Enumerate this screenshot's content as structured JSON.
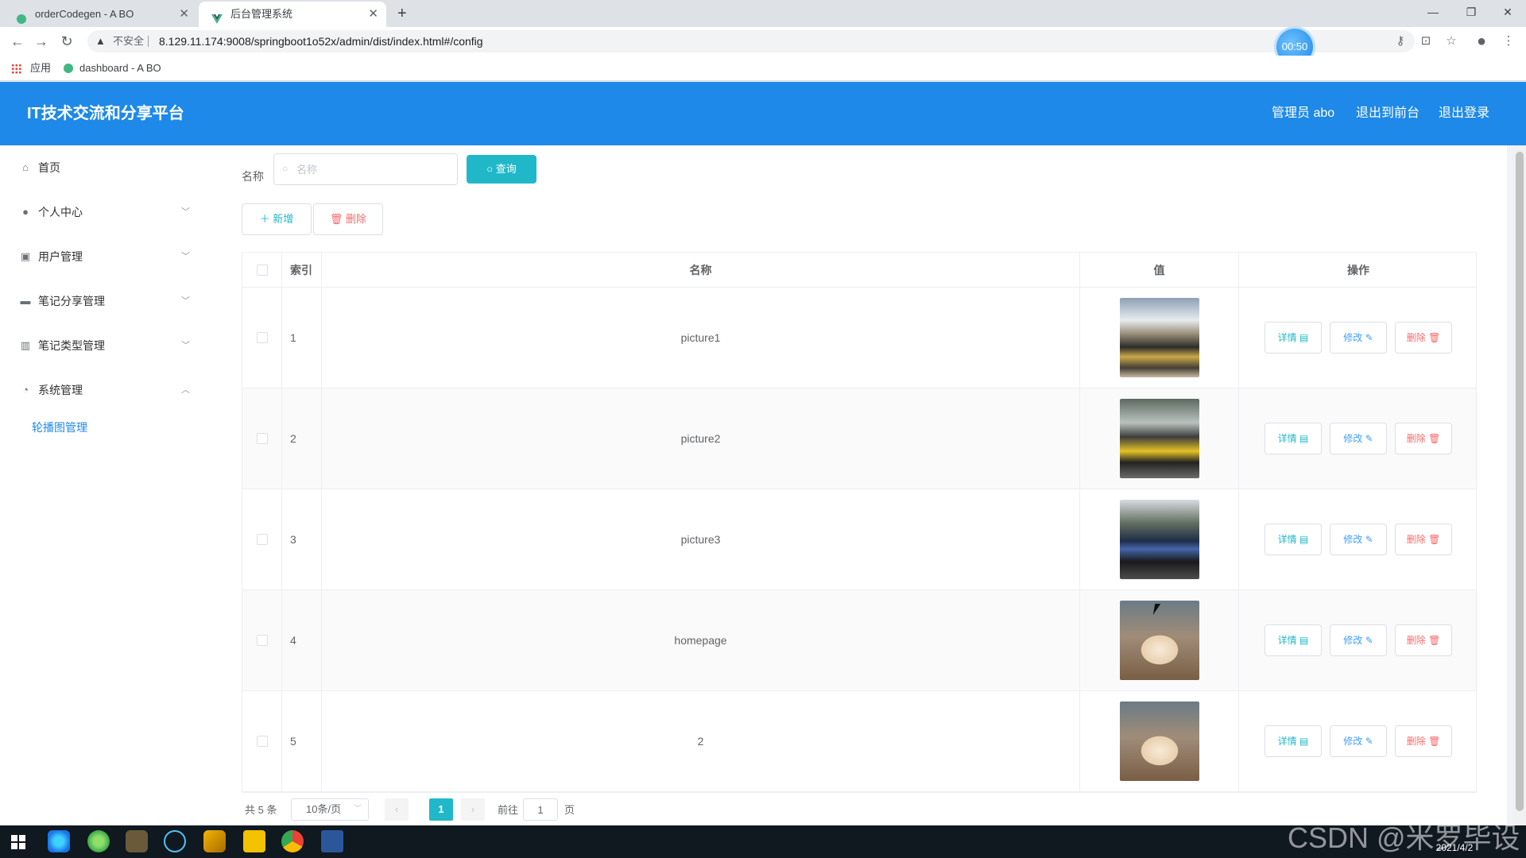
{
  "browser": {
    "tabs": [
      {
        "label": "orderCodegen - A BO",
        "active": false
      },
      {
        "label": "后台管理系统",
        "active": true
      }
    ],
    "security_label": "不安全",
    "url": "8.129.11.174:9008/springboot1o52x/admin/dist/index.html#/config",
    "timer": "00:50",
    "bookmarks": [
      {
        "label": "应用"
      },
      {
        "label": "dashboard - A BO"
      }
    ]
  },
  "header": {
    "title": "IT技术交流和分享平台",
    "links": [
      {
        "label": "管理员 abo"
      },
      {
        "label": "退出到前台"
      },
      {
        "label": "退出登录"
      }
    ]
  },
  "sidebar": {
    "items": [
      {
        "label": "首页",
        "icon": "home-icon"
      },
      {
        "label": "个人中心",
        "icon": "user-icon",
        "expanded": false
      },
      {
        "label": "用户管理",
        "icon": "clipboard-icon",
        "expanded": false
      },
      {
        "label": "笔记分享管理",
        "icon": "briefcase-icon",
        "expanded": false
      },
      {
        "label": "笔记类型管理",
        "icon": "chart-icon",
        "expanded": false
      },
      {
        "label": "系统管理",
        "icon": "compass-icon",
        "expanded": true
      }
    ],
    "submenu": [
      {
        "label": "轮播图管理",
        "active": true
      }
    ]
  },
  "search": {
    "label": "名称",
    "placeholder": "名称",
    "value": "",
    "button_label": "查询"
  },
  "toolbar": {
    "add_label": "新增",
    "delete_label": "删除"
  },
  "table": {
    "columns": [
      "索引",
      "名称",
      "值",
      "操作"
    ],
    "rows": [
      {
        "index": "1",
        "name": "picture1",
        "image": "cars"
      },
      {
        "index": "2",
        "name": "picture2",
        "image": "yellow-car"
      },
      {
        "index": "3",
        "name": "picture3",
        "image": "blue-car"
      },
      {
        "index": "4",
        "name": "homepage",
        "image": "cat"
      },
      {
        "index": "5",
        "name": "2",
        "image": "cat"
      }
    ],
    "actions": {
      "detail": "详情",
      "edit": "修改",
      "delete": "删除"
    }
  },
  "pagination": {
    "total_text": "共 5 条",
    "page_size": "10条/页",
    "current_page": "1",
    "goto_label": "前往",
    "goto_value": "1",
    "page_suffix": "页"
  },
  "taskbar": {
    "date": "2021/4/2",
    "watermark": "CSDN @米罗毕设"
  },
  "colors": {
    "header_bg": "#1e89e8",
    "accent_teal": "#20b8c8",
    "danger": "#f56c6c",
    "primary": "#409eff"
  }
}
